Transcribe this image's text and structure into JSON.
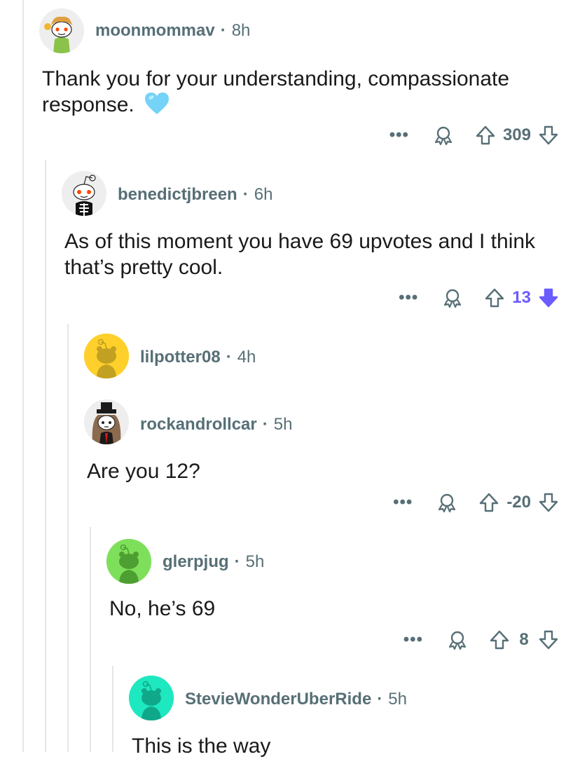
{
  "comments": [
    {
      "username": "moonmommav",
      "time": "8h",
      "body": "Thank you for your understanding, compassionate response.",
      "emoji": "light-blue-heart",
      "score": "309",
      "vote": "none",
      "avatar_color": "#f2f2f2"
    },
    {
      "username": "benedictjbreen",
      "time": "6h",
      "body": "As of this moment you have 69 upvotes and I think that’s pretty cool.",
      "score": "13",
      "vote": "down",
      "avatar_color": "#f2f2f2"
    },
    {
      "username": "lilpotter08",
      "time": "4h",
      "avatar_color": "#ffd02b"
    },
    {
      "username": "rockandrollcar",
      "time": "5h",
      "body": "Are you 12?",
      "score": "-20",
      "vote": "none",
      "avatar_color": "#f2f2f2"
    },
    {
      "username": "glerpjug",
      "time": "5h",
      "body": "No, he’s 69",
      "score": "8",
      "vote": "none",
      "avatar_color": "#7ee05a"
    },
    {
      "username": "StevieWonderUberRide",
      "time": "5h",
      "body": "This is the way",
      "avatar_color": "#1ee8bf"
    }
  ],
  "colors": {
    "meta_text": "#576f76",
    "downvote_active": "#6a5cff",
    "thread_line": "#e4e6e8"
  },
  "icons": [
    "more-icon",
    "award-icon",
    "upvote-icon",
    "downvote-icon",
    "heart-emoji-icon"
  ]
}
